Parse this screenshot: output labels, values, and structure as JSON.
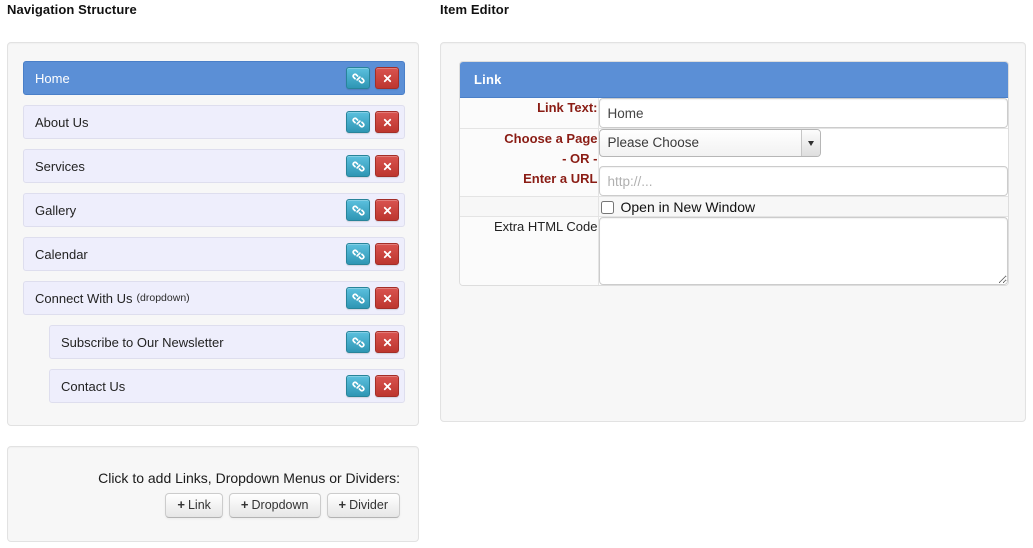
{
  "headings": {
    "navigation": "Navigation Structure",
    "editor": "Item Editor"
  },
  "navigation": {
    "items": [
      {
        "label": "Home",
        "suffix": "",
        "selected": true,
        "indent": false
      },
      {
        "label": "About Us",
        "suffix": "",
        "selected": false,
        "indent": false
      },
      {
        "label": "Services",
        "suffix": "",
        "selected": false,
        "indent": false
      },
      {
        "label": "Gallery",
        "suffix": "",
        "selected": false,
        "indent": false
      },
      {
        "label": "Calendar",
        "suffix": "",
        "selected": false,
        "indent": false
      },
      {
        "label": "Connect With Us",
        "suffix": "(dropdown)",
        "selected": false,
        "indent": false
      },
      {
        "label": "Subscribe to Our Newsletter",
        "suffix": "",
        "selected": false,
        "indent": true
      },
      {
        "label": "Contact Us",
        "suffix": "",
        "selected": false,
        "indent": true
      }
    ],
    "row_actions": {
      "edit_icon": "link-icon",
      "delete_icon": "close-x-icon"
    }
  },
  "add_panel": {
    "prompt": "Click to add Links, Dropdown Menus or Dividers:",
    "buttons": [
      {
        "plus": "+",
        "label": "Link"
      },
      {
        "plus": "+",
        "label": "Dropdown"
      },
      {
        "plus": "+",
        "label": "Divider"
      }
    ]
  },
  "editor": {
    "panel_title": "Link",
    "fields": {
      "link_text": {
        "label": "Link Text:",
        "value": "Home",
        "placeholder": ""
      },
      "choose_page": {
        "label_line1": "Choose a Page",
        "label_line2": "- OR -",
        "label_line3": "Enter a URL",
        "select_value": "Please Choose",
        "select_options": [
          "Please Choose"
        ],
        "url_value": "",
        "url_placeholder": "http://..."
      },
      "new_window": {
        "label": "Open in New Window",
        "checked": false
      },
      "extra_html": {
        "label": "Extra HTML Code",
        "value": "",
        "placeholder": ""
      }
    }
  },
  "colors": {
    "accent_blue": "#5b8fd6",
    "item_bg": "#eeeefc",
    "label_red": "#8a1c14",
    "info_blue": "#2f96b4",
    "danger_red": "#bd362f"
  }
}
